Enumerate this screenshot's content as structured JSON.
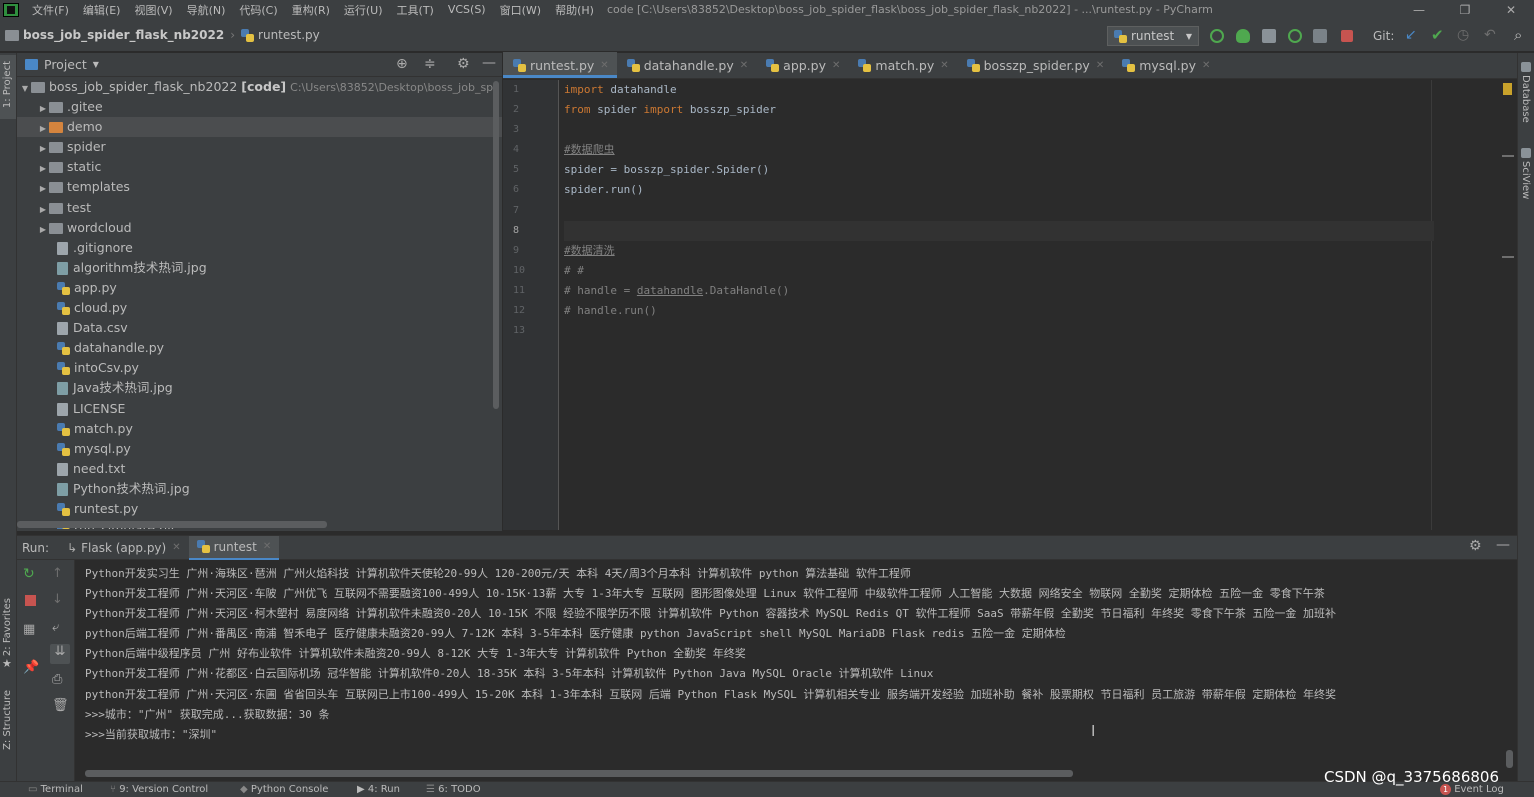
{
  "menubar": {
    "items": [
      "文件(F)",
      "编辑(E)",
      "视图(V)",
      "导航(N)",
      "代码(C)",
      "重构(R)",
      "运行(U)",
      "工具(T)",
      "VCS(S)",
      "窗口(W)",
      "帮助(H)"
    ],
    "title": "code [C:\\Users\\83852\\Desktop\\boss_job_spider_flask\\boss_job_spider_flask_nb2022] - ...\\runtest.py - PyCharm"
  },
  "navbar": {
    "project": "boss_job_spider_flask_nb2022",
    "file": "runtest.py",
    "run_config": "runtest",
    "git_label": "Git:"
  },
  "project_panel": {
    "title": "Project",
    "root": {
      "name": "boss_job_spider_flask_nb2022",
      "tag": "[code]",
      "path": "C:\\Users\\83852\\Desktop\\boss_job_sp"
    },
    "folders": [
      ".gitee",
      "demo",
      "spider",
      "static",
      "templates",
      "test",
      "wordcloud"
    ],
    "files": [
      ".gitignore",
      "algorithm技术热词.jpg",
      "app.py",
      "cloud.py",
      "Data.csv",
      "datahandle.py",
      "intoCsv.py",
      "Java技术热词.jpg",
      "LICENSE",
      "match.py",
      "mysql.py",
      "need.txt",
      "Python技术热词.jpg",
      "runtest.py",
      "run_simulate.py"
    ]
  },
  "editor": {
    "tabs": [
      "runtest.py",
      "datahandle.py",
      "app.py",
      "match.py",
      "bosszp_spider.py",
      "mysql.py"
    ],
    "line_numbers": [
      "1",
      "2",
      "3",
      "4",
      "5",
      "6",
      "7",
      "8",
      "9",
      "10",
      "11",
      "12",
      "13"
    ],
    "code": {
      "l1_kw": "import",
      "l1_rest": " datahandle",
      "l2_kw1": "from",
      "l2_mid": " spider ",
      "l2_kw2": "import",
      "l2_rest": " bosszp_spider",
      "l4": "#数据爬虫",
      "l5": "spider = bosszp_spider.Spider()",
      "l6": "spider.run()",
      "l9": "#数据清洗",
      "l10": "# #",
      "l11_a": "# handle = ",
      "l11_b": "datahandle",
      "l11_c": ".DataHandle()",
      "l12": "# handle.run()"
    }
  },
  "run_panel": {
    "label": "Run:",
    "tabs": [
      "Flask (app.py)",
      "runtest"
    ],
    "output": [
      "Python开发实习生 广州·海珠区·琶洲 广州火焰科技 计算机软件天使轮20-99人 120-200元/天 本科 4天/周3个月本科 计算机软件 python 算法基础 软件工程师",
      "Python开发工程师 广州·天河区·车陂 广州优飞 互联网不需要融资100-499人 10-15K·13薪 大专 1-3年大专 互联网 图形图像处理 Linux 软件工程师 中级软件工程师 人工智能 大数据 网络安全 物联网 全勤奖 定期体检 五险一金 零食下午茶",
      "Python开发工程师 广州·天河区·柯木塱村 易度网络 计算机软件未融资0-20人 10-15K 不限 经验不限学历不限 计算机软件 Python 容器技术 MySQL Redis QT 软件工程师 SaaS 带薪年假 全勤奖 节日福利 年终奖 零食下午茶 五险一金 加班补",
      "python后端工程师 广州·番禺区·南浦 智禾电子 医疗健康未融资20-99人 7-12K 本科 3-5年本科 医疗健康 python JavaScript shell MySQL MariaDB Flask redis 五险一金 定期体检",
      "Python后端中级程序员 广州 好布业软件 计算机软件未融资20-99人 8-12K 大专 1-3年大专 计算机软件 Python 全勤奖 年终奖",
      "Python开发工程师 广州·花都区·白云国际机场 冠华智能 计算机软件0-20人 18-35K 本科 3-5年本科 计算机软件 Python Java MySQL Oracle 计算机软件 Linux",
      "python开发工程师 广州·天河区·东圃 省省回头车 互联网已上市100-499人 15-20K 本科 1-3年本科 互联网 后端 Python Flask MySQL 计算机相关专业 服务端开发经验 加班补助 餐补 股票期权 节日福利 员工旅游 带薪年假 定期体检 年终奖",
      ">>>城市：\"广州\" 获取完成...获取数据：30 条",
      ">>>当前获取城市：\"深圳\""
    ]
  },
  "leftstrip": {
    "project": "1: Project",
    "favorites": "2: Favorites",
    "structure": "Z: Structure"
  },
  "rightstrip": {
    "database": "Database",
    "sciview": "SciView"
  },
  "statusbar": {
    "items": [
      "Terminal",
      "9: Version Control",
      "Python Console",
      "4: Run",
      "6: TODO"
    ],
    "event_log": "Event Log",
    "event_count": "1"
  },
  "watermark": "CSDN @q_3375686806"
}
